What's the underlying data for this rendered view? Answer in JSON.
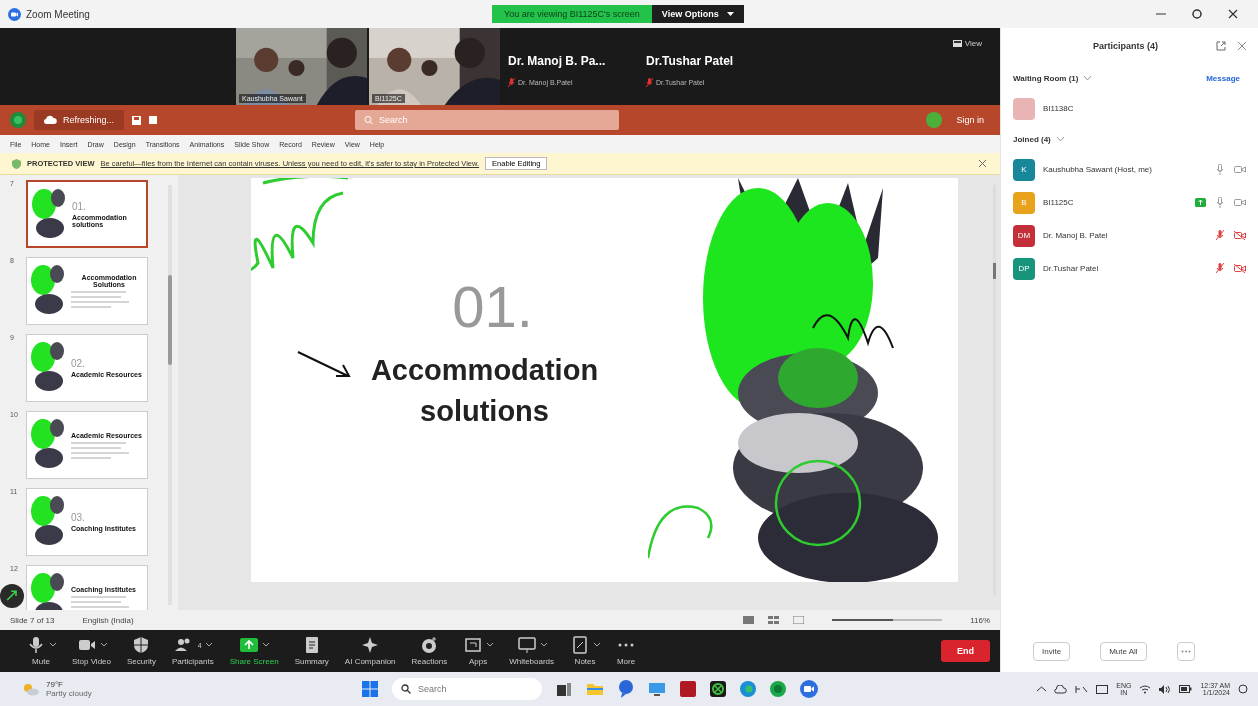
{
  "window": {
    "title": "Zoom Meeting"
  },
  "share_banner": {
    "text": "You are viewing BI1125C's screen",
    "view_options": "View Options"
  },
  "video_strip": {
    "view_label": "View",
    "tiles": [
      {
        "kind": "video",
        "name": "Kaushubha Sawant"
      },
      {
        "kind": "video",
        "name": "BI1125C"
      },
      {
        "kind": "name",
        "display": "Dr. Manoj  B. Pa...",
        "name": "Dr. Manoj  B.Patel",
        "muted": true
      },
      {
        "kind": "name",
        "display": "Dr.Tushar Patel",
        "name": "Dr.Tushar Patel",
        "muted": true
      }
    ]
  },
  "powerpoint": {
    "status": "Refreshing...",
    "search_placeholder": "Search",
    "sign_in": "Sign in",
    "tabs": [
      "File",
      "Home",
      "Insert",
      "Draw",
      "Design",
      "Transitions",
      "Animations",
      "Slide Show",
      "Record",
      "Review",
      "View",
      "Help"
    ],
    "protected_view": {
      "label": "PROTECTED VIEW",
      "message": "Be careful—files from the Internet can contain viruses. Unless you need to edit, it's safer to stay in Protected View.",
      "button": "Enable Editing"
    },
    "thumbnails": [
      {
        "number": "7",
        "selected": true,
        "kind": "section",
        "index": "01.",
        "title": "Accommodation solutions"
      },
      {
        "number": "8",
        "selected": false,
        "kind": "content",
        "title": "Accommodation Solutions"
      },
      {
        "number": "9",
        "selected": false,
        "kind": "section",
        "index": "02.",
        "title": "Academic Resources"
      },
      {
        "number": "10",
        "selected": false,
        "kind": "content",
        "title": "Academic Resources"
      },
      {
        "number": "11",
        "selected": false,
        "kind": "section",
        "index": "03.",
        "title": "Coaching Institutes"
      },
      {
        "number": "12",
        "selected": false,
        "kind": "content",
        "title": "Coaching Institutes"
      }
    ],
    "slide": {
      "index": "01.",
      "title": "Accommodation solutions"
    },
    "status_bar": {
      "slide": "Slide 7 of 13",
      "language": "English (India)",
      "zoom": "116%",
      "level": 0.55
    }
  },
  "toolbar": {
    "items": [
      {
        "kind": "mic",
        "label": "Mute",
        "caret": true,
        "active": false
      },
      {
        "kind": "video",
        "label": "Stop Video",
        "caret": true,
        "active": false
      },
      {
        "kind": "security",
        "label": "Security",
        "caret": false,
        "active": false
      },
      {
        "kind": "participants",
        "label": "Participants",
        "count": "4",
        "caret": true,
        "active": false
      },
      {
        "kind": "share",
        "label": "Share Screen",
        "caret": true,
        "active": true
      },
      {
        "kind": "summary",
        "label": "Summary",
        "caret": false,
        "active": false
      },
      {
        "kind": "ai",
        "label": "AI Companion",
        "caret": false,
        "active": false
      },
      {
        "kind": "reactions",
        "label": "Reactions",
        "caret": false,
        "active": false
      },
      {
        "kind": "apps",
        "label": "Apps",
        "caret": true,
        "active": false
      },
      {
        "kind": "whiteboard",
        "label": "Whiteboards",
        "caret": true,
        "active": false
      },
      {
        "kind": "notes",
        "label": "Notes",
        "caret": true,
        "active": false
      },
      {
        "kind": "more",
        "label": "More",
        "caret": false,
        "active": false
      }
    ],
    "end": "End"
  },
  "participants_panel": {
    "title": "Participants (4)",
    "waiting_room": {
      "label": "Waiting Room (1)",
      "message": "Message",
      "people": [
        {
          "name": "BI1138C",
          "color": "#e8b4b4"
        }
      ]
    },
    "joined": {
      "label": "Joined (4)",
      "people": [
        {
          "initials": "K",
          "name": "Kaushubha Sawant (Host, me)",
          "color": "#17879a",
          "sharing": false,
          "mic_muted": false
        },
        {
          "initials": "B",
          "name": "BI1125C",
          "color": "#e8a21c",
          "sharing": true,
          "mic_muted": false
        },
        {
          "initials": "DM",
          "name": "Dr. Manoj  B. Patel",
          "color": "#c4303a",
          "sharing": false,
          "mic_muted": true
        },
        {
          "initials": "DP",
          "name": "Dr.Tushar Patel",
          "color": "#17957a",
          "sharing": false,
          "mic_muted": true
        }
      ]
    },
    "buttons": [
      "Invite",
      "Mute All"
    ]
  },
  "taskbar": {
    "temperature": "79°F",
    "weather": "Partly cloudy",
    "search_placeholder": "Search",
    "language": "ENG",
    "region": "IN",
    "time": "12:37 AM",
    "date": "1/1/2024"
  }
}
